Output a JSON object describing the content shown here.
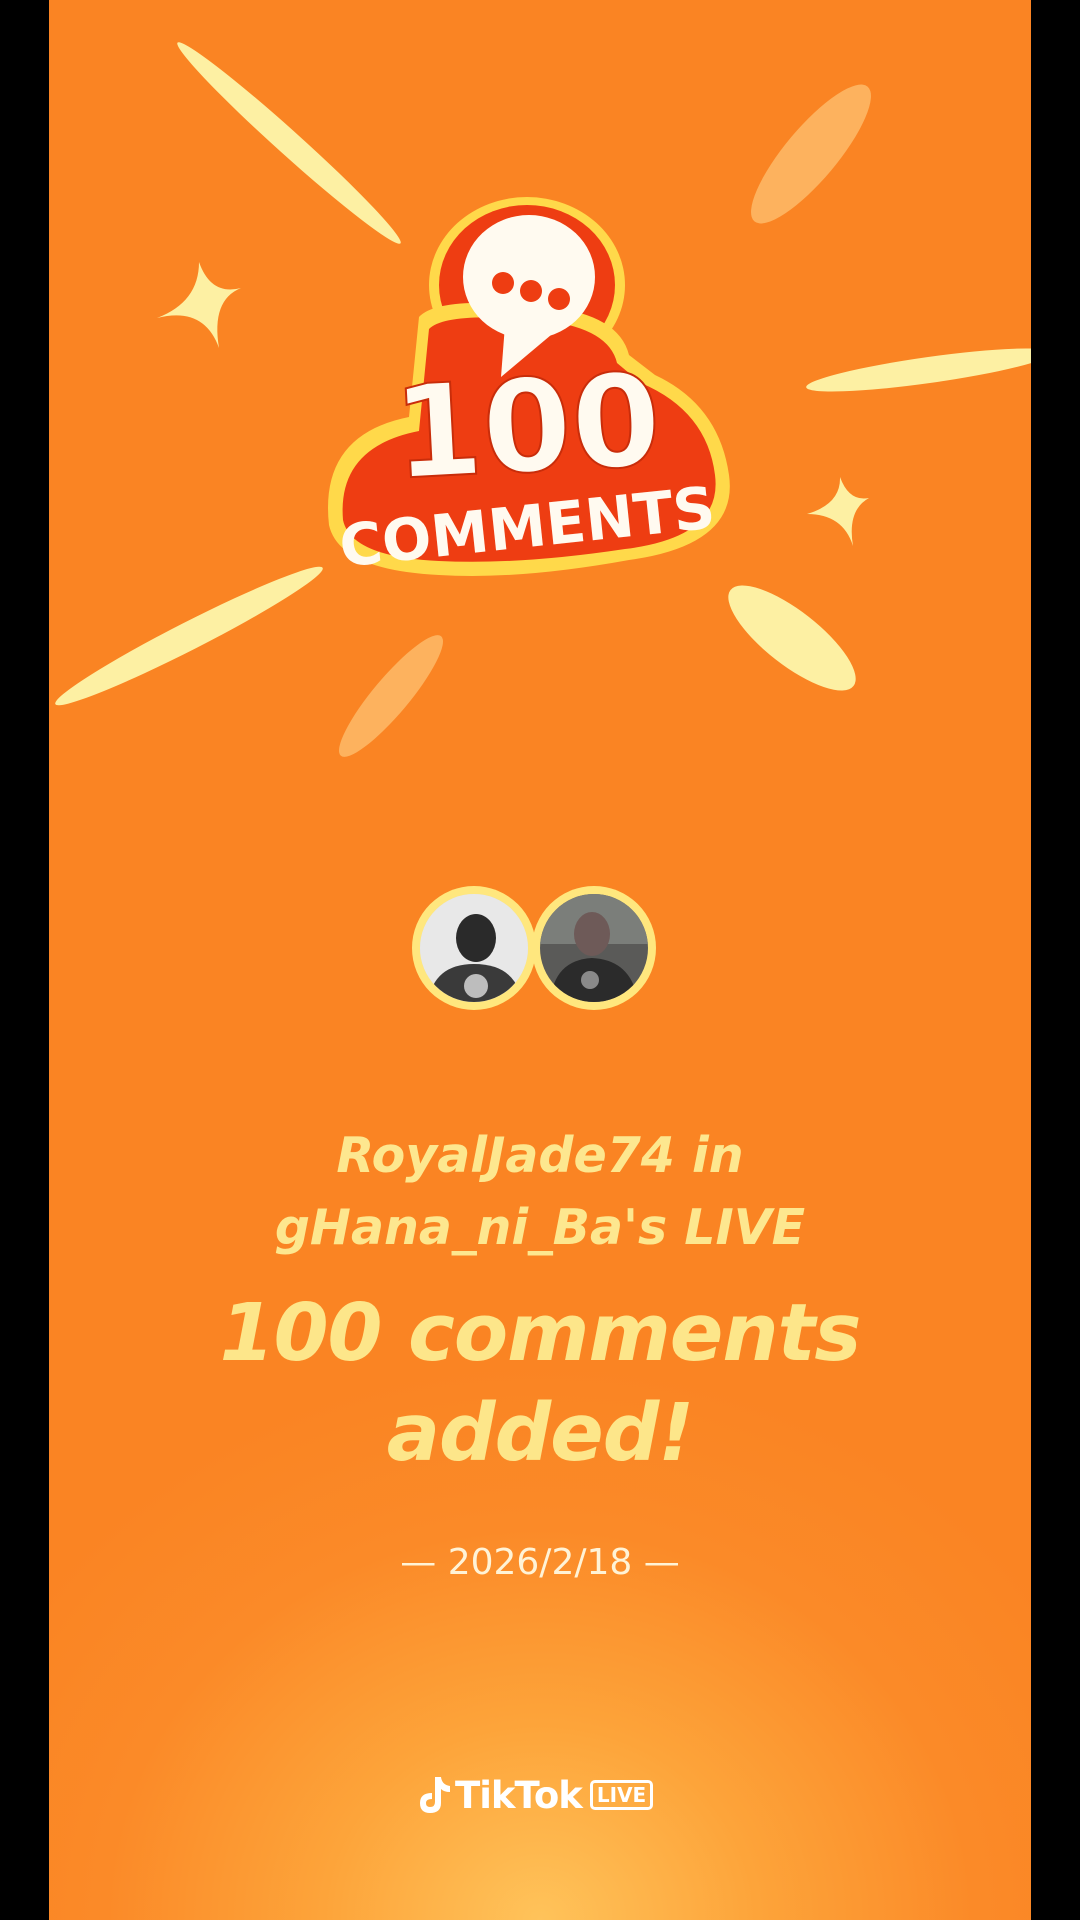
{
  "badge": {
    "number": "100",
    "word": "COMMENTS",
    "icon": "speech-bubble-icon"
  },
  "avatars": [
    {
      "name": "avatar-royaljade74"
    },
    {
      "name": "avatar-ghana-ni-ba"
    }
  ],
  "subtitle": {
    "line1": "RoyalJade74 in",
    "line2": "gHana_ni_Ba's LIVE"
  },
  "headline": {
    "line1": "100 comments",
    "line2": "added!"
  },
  "date": "— 2026/2/18 —",
  "logo": {
    "word": "TikTok",
    "badge": "LIVE",
    "icon": "tiktok-note-icon"
  },
  "colors": {
    "background": "#fa8423",
    "accent_yellow": "#fde68a",
    "badge_red": "#ee3d12"
  }
}
